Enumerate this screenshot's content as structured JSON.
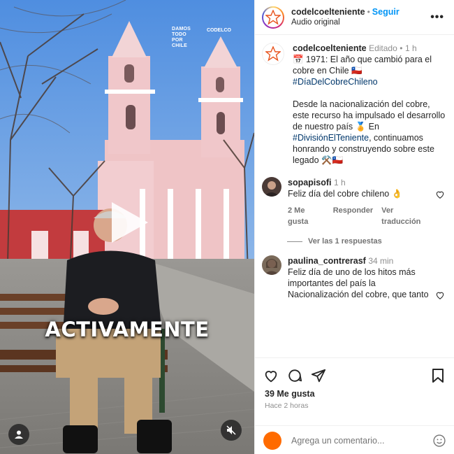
{
  "video": {
    "overlay_logo_text": "DAMOS\nTODO\nPOR\nCHILE",
    "overlay_logo2_text": "CODELCO",
    "caption_text": "ACTIVAMENTE"
  },
  "post": {
    "username": "codelcoelteniente",
    "follow_label": "Seguir",
    "audio_label": "Audio original",
    "more_label": "•••",
    "caption": {
      "username": "codelcoelteniente",
      "edited_label": "Editado",
      "time": "1 h",
      "line1": "📅 1971: El año que cambió para el cobre en Chile 🇨🇱 ",
      "hashtag1": "#DíaDelCobreChileno",
      "para2_a": "Desde la nacionalización del cobre, este recurso ha impulsado el desarrollo de nuestro país 🏅 En ",
      "hashtag2": "#DivisiónElTeniente",
      "para2_b": ", continuamos honrando y construyendo sobre este legado ⚒️🇨🇱"
    }
  },
  "comments": [
    {
      "username": "sopapisofi",
      "time": "1 h",
      "text": "Feliz día del cobre chileno 👌",
      "likes": "2 Me gusta",
      "reply_label": "Responder",
      "translate_label": "Ver traducción",
      "view_replies": "Ver las 1 respuestas"
    },
    {
      "username": "paulina_contrerasf",
      "time": "34 min",
      "text": "Feliz día de uno de los hitos más importantes del país la Nacionalización del cobre, que tanto"
    }
  ],
  "footer": {
    "likes": "39 Me gusta",
    "time_ago": "Hace 2 horas",
    "comment_placeholder": "Agrega un comentario..."
  },
  "colors": {
    "accent": "#0095f6",
    "hashtag": "#00376b",
    "muted": "#8e8e8e"
  }
}
